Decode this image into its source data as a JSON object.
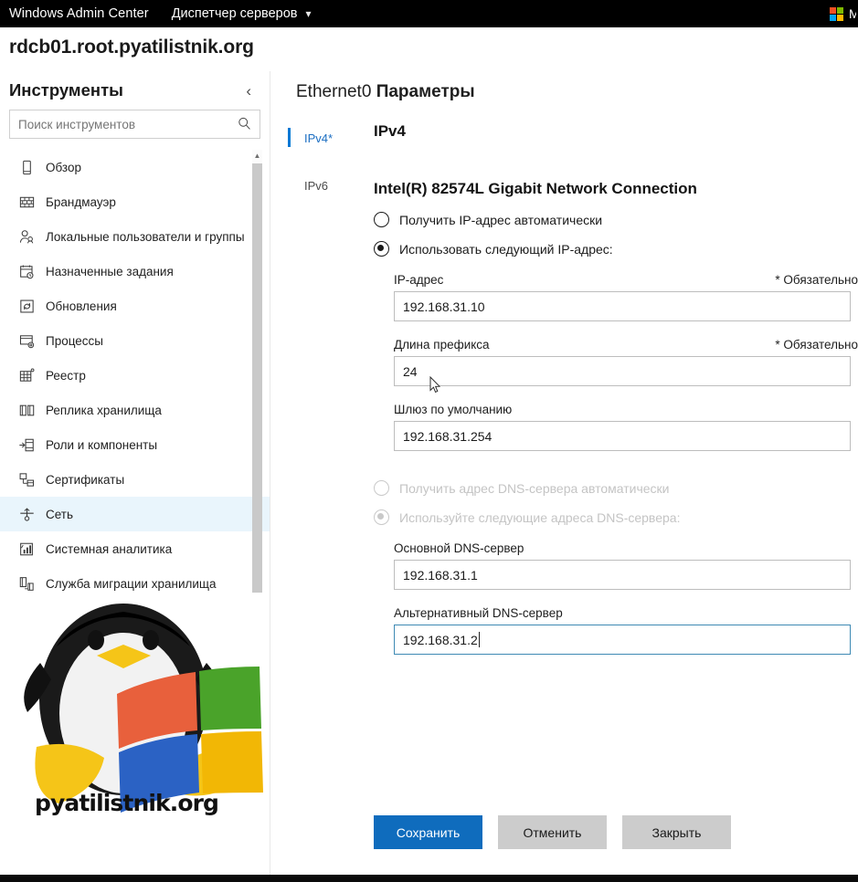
{
  "topbar": {
    "brand": "Windows Admin Center",
    "app": "Диспетчер серверов",
    "chevron": "chevron-down",
    "user_initial": "M"
  },
  "page": {
    "title": "rdcb01.root.pyatilistnik.org"
  },
  "sidebar": {
    "heading": "Инструменты",
    "collapse_glyph": "‹",
    "search": {
      "placeholder": "Поиск инструментов",
      "value": ""
    },
    "items": [
      {
        "label": "Обзор",
        "icon": "device-icon",
        "selected": false
      },
      {
        "label": "Брандмауэр",
        "icon": "firewall-grid-icon",
        "selected": false
      },
      {
        "label": "Локальные пользователи и группы",
        "icon": "users-icon",
        "selected": false
      },
      {
        "label": "Назначенные задания",
        "icon": "scheduled-tasks-icon",
        "selected": false
      },
      {
        "label": "Обновления",
        "icon": "updates-icon",
        "selected": false
      },
      {
        "label": "Процессы",
        "icon": "processes-icon",
        "selected": false
      },
      {
        "label": "Реестр",
        "icon": "registry-icon",
        "selected": false
      },
      {
        "label": "Реплика хранилища",
        "icon": "storage-replica-icon",
        "selected": false
      },
      {
        "label": "Роли и компоненты",
        "icon": "roles-features-icon",
        "selected": false
      },
      {
        "label": "Сертификаты",
        "icon": "certificates-icon",
        "selected": false
      },
      {
        "label": "Сеть",
        "icon": "network-icon",
        "selected": true
      },
      {
        "label": "Системная аналитика",
        "icon": "system-insights-icon",
        "selected": false
      },
      {
        "label": "Служба миграции хранилища",
        "icon": "storage-migration-icon",
        "selected": false
      }
    ],
    "scrollbar": {
      "up_glyph": "▲"
    }
  },
  "watermark": {
    "text": "pyatilistnik.org",
    "image": "tux-penguin-windows-logo"
  },
  "main": {
    "header_prefix": "Ethernet0",
    "header_suffix": "Параметры",
    "tabs": [
      {
        "label": "IPv4*",
        "active": true
      },
      {
        "label": "IPv6",
        "active": false
      }
    ],
    "section_title": "IPv4",
    "adapter_title": "Intel(R) 82574L Gigabit Network Connection",
    "ip_mode": {
      "auto": {
        "label": "Получить IP-адрес автоматически",
        "checked": false,
        "disabled": false
      },
      "manual": {
        "label": "Использовать следующий IP-адрес:",
        "checked": true,
        "disabled": false
      }
    },
    "fields": [
      {
        "label": "IP-адрес",
        "required_text": "* Обязательно",
        "value": "192.168.31.10",
        "focused": false
      },
      {
        "label": "Длина префикса",
        "required_text": "* Обязательно",
        "value": "24",
        "focused": false
      },
      {
        "label": "Шлюз по умолчанию",
        "required_text": "",
        "value": "192.168.31.254",
        "focused": false
      }
    ],
    "dns_mode": {
      "auto": {
        "label": "Получить адрес DNS-сервера автоматически",
        "checked": false,
        "disabled": true
      },
      "manual": {
        "label": "Используйте следующие адреса DNS-сервера:",
        "checked": true,
        "disabled": true
      }
    },
    "dns_fields": [
      {
        "label": "Основной DNS-сервер",
        "required_text": "",
        "value": "192.168.31.1",
        "focused": false
      },
      {
        "label": "Альтернативный DNS-сервер",
        "required_text": "",
        "value": "192.168.31.2",
        "focused": true
      }
    ],
    "buttons": [
      {
        "label": "Сохранить",
        "style": "primary"
      },
      {
        "label": "Отменить",
        "style": "secondary"
      },
      {
        "label": "Закрыть",
        "style": "secondary"
      }
    ]
  },
  "colors": {
    "accent": "#0f6cbd",
    "tab_active": "#0078d4",
    "selected_row": "#e9f5fc",
    "topbar_bg": "#000000"
  }
}
